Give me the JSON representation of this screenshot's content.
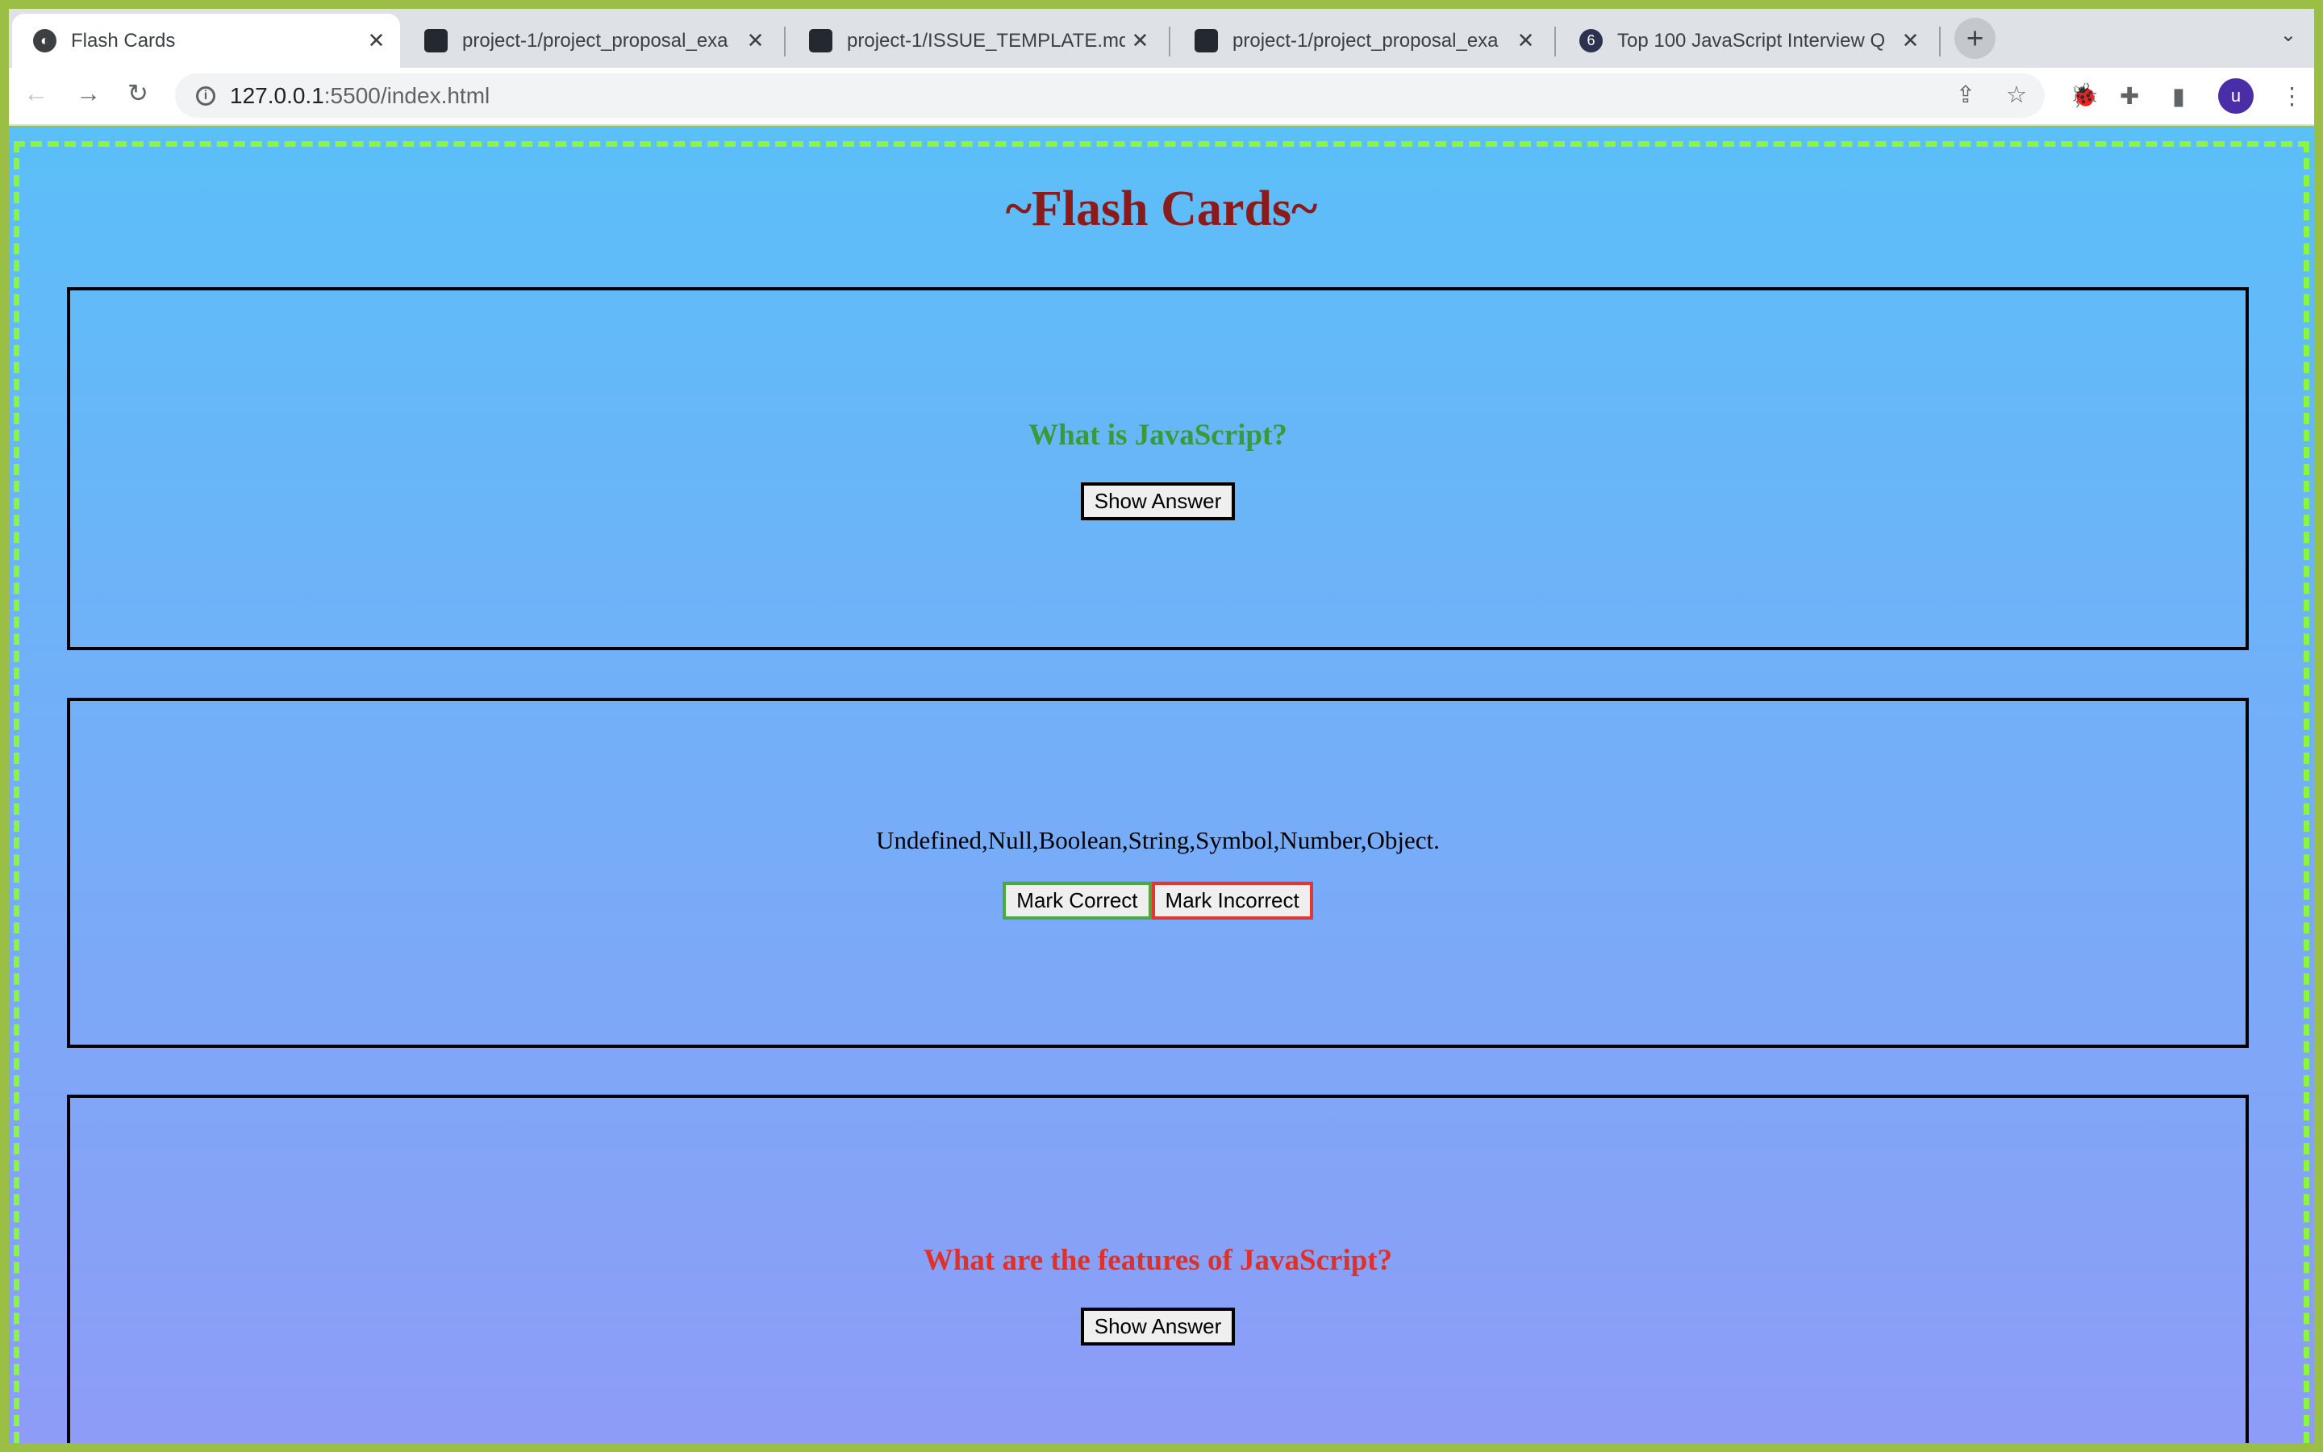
{
  "browser": {
    "tabs": [
      {
        "title": "Flash Cards",
        "icon": "globe-icon",
        "active": true
      },
      {
        "title": "project-1/project_proposal_exa",
        "icon": "github-icon"
      },
      {
        "title": "project-1/ISSUE_TEMPLATE.md",
        "icon": "github-icon"
      },
      {
        "title": "project-1/project_proposal_exa",
        "icon": "github-icon"
      },
      {
        "title": "Top 100 JavaScript Interview Q",
        "icon": "site-icon"
      }
    ],
    "url_host": "127.0.0.1",
    "url_rest": ":5500/index.html",
    "avatar_letter": "u"
  },
  "page": {
    "title": "~Flash Cards~",
    "cards": [
      {
        "question": "What is JavaScript?",
        "button": "Show Answer",
        "color": "#3a9a3a"
      },
      {
        "answer": "Undefined,Null,Boolean,String,Symbol,Number,Object.",
        "correct": "Mark Correct",
        "incorrect": "Mark Incorrect"
      },
      {
        "question": "What are the features of JavaScript?",
        "button": "Show Answer",
        "color": "#e0302a"
      }
    ]
  }
}
